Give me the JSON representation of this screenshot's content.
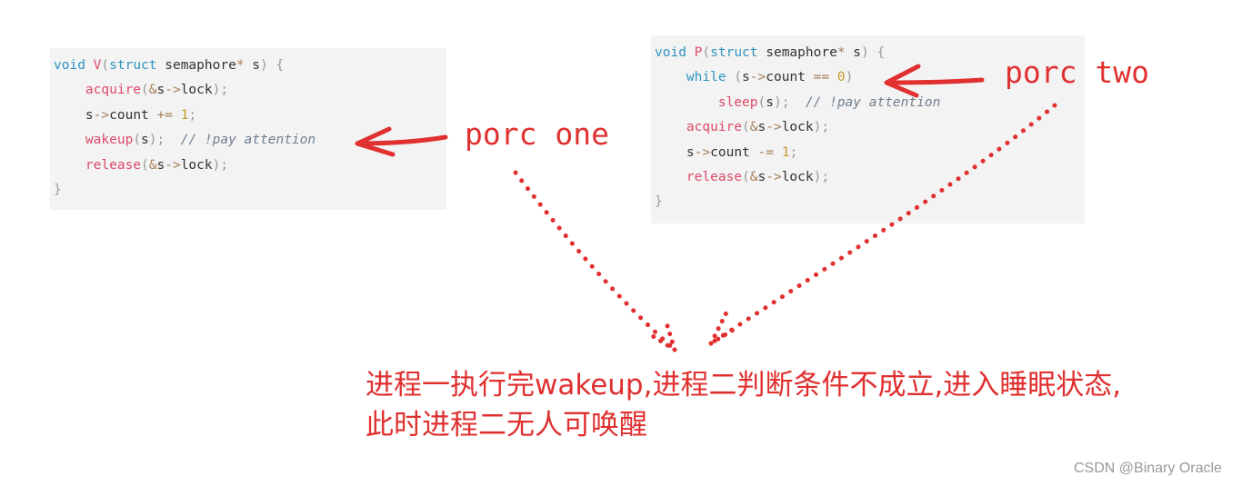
{
  "code_v": [
    [
      [
        "void",
        "kw"
      ],
      [
        " ",
        "tx"
      ],
      [
        "V",
        "fn"
      ],
      [
        "(",
        "pu"
      ],
      [
        "struct",
        "kw"
      ],
      [
        " semaphore",
        "tx"
      ],
      [
        "*",
        "op"
      ],
      [
        " s",
        "tx"
      ],
      [
        ")",
        "pu"
      ],
      [
        " ",
        "tx"
      ],
      [
        "{",
        "pu"
      ]
    ],
    [
      [
        "    ",
        "tx"
      ],
      [
        "acquire",
        "fn"
      ],
      [
        "(",
        "pu"
      ],
      [
        "&",
        "op"
      ],
      [
        "s",
        "tx"
      ],
      [
        "->",
        "op"
      ],
      [
        "lock",
        "tx"
      ],
      [
        ");",
        "pu"
      ]
    ],
    [
      [
        "    s",
        "tx"
      ],
      [
        "->",
        "op"
      ],
      [
        "count ",
        "tx"
      ],
      [
        "+=",
        "op"
      ],
      [
        " ",
        "tx"
      ],
      [
        "1",
        "num"
      ],
      [
        ";",
        "pu"
      ]
    ],
    [
      [
        "    ",
        "tx"
      ],
      [
        "wakeup",
        "fn"
      ],
      [
        "(",
        "pu"
      ],
      [
        "s",
        "tx"
      ],
      [
        ");",
        "pu"
      ],
      [
        "  // !pay attention",
        "cm"
      ]
    ],
    [
      [
        "    ",
        "tx"
      ],
      [
        "release",
        "fn"
      ],
      [
        "(",
        "pu"
      ],
      [
        "&",
        "op"
      ],
      [
        "s",
        "tx"
      ],
      [
        "->",
        "op"
      ],
      [
        "lock",
        "tx"
      ],
      [
        ");",
        "pu"
      ]
    ],
    [
      [
        "}",
        "pu"
      ]
    ]
  ],
  "code_p": [
    [
      [
        "void",
        "kw"
      ],
      [
        " ",
        "tx"
      ],
      [
        "P",
        "fn"
      ],
      [
        "(",
        "pu"
      ],
      [
        "struct",
        "kw"
      ],
      [
        " semaphore",
        "tx"
      ],
      [
        "*",
        "op"
      ],
      [
        " s",
        "tx"
      ],
      [
        ")",
        "pu"
      ],
      [
        " ",
        "tx"
      ],
      [
        "{",
        "pu"
      ]
    ],
    [
      [
        "    ",
        "tx"
      ],
      [
        "while",
        "kw"
      ],
      [
        " ",
        "tx"
      ],
      [
        "(",
        "pu"
      ],
      [
        "s",
        "tx"
      ],
      [
        "->",
        "op"
      ],
      [
        "count ",
        "tx"
      ],
      [
        "==",
        "op"
      ],
      [
        " ",
        "tx"
      ],
      [
        "0",
        "num"
      ],
      [
        ")",
        "pu"
      ]
    ],
    [
      [
        "        ",
        "tx"
      ],
      [
        "sleep",
        "fn"
      ],
      [
        "(",
        "pu"
      ],
      [
        "s",
        "tx"
      ],
      [
        ");",
        "pu"
      ],
      [
        "  // !pay attention",
        "cm"
      ]
    ],
    [
      [
        "    ",
        "tx"
      ],
      [
        "acquire",
        "fn"
      ],
      [
        "(",
        "pu"
      ],
      [
        "&",
        "op"
      ],
      [
        "s",
        "tx"
      ],
      [
        "->",
        "op"
      ],
      [
        "lock",
        "tx"
      ],
      [
        ");",
        "pu"
      ]
    ],
    [
      [
        "    s",
        "tx"
      ],
      [
        "->",
        "op"
      ],
      [
        "count ",
        "tx"
      ],
      [
        "-=",
        "op"
      ],
      [
        " ",
        "tx"
      ],
      [
        "1",
        "num"
      ],
      [
        ";",
        "pu"
      ]
    ],
    [
      [
        "    ",
        "tx"
      ],
      [
        "release",
        "fn"
      ],
      [
        "(",
        "pu"
      ],
      [
        "&",
        "op"
      ],
      [
        "s",
        "tx"
      ],
      [
        "->",
        "op"
      ],
      [
        "lock",
        "tx"
      ],
      [
        ");",
        "pu"
      ]
    ],
    [
      [
        "}",
        "pu"
      ]
    ]
  ],
  "annotations": {
    "proc_one": "porc one",
    "proc_two": "porc two",
    "note_line1": "进程一执行完wakeup,进程二判断条件不成立,进入睡眠状态,",
    "note_line2": "此时进程二无人可唤醒"
  },
  "watermark": "CSDN @Binary Oracle",
  "colors": {
    "annotation": "#e03030",
    "code_bg": "#f3f3f3"
  }
}
